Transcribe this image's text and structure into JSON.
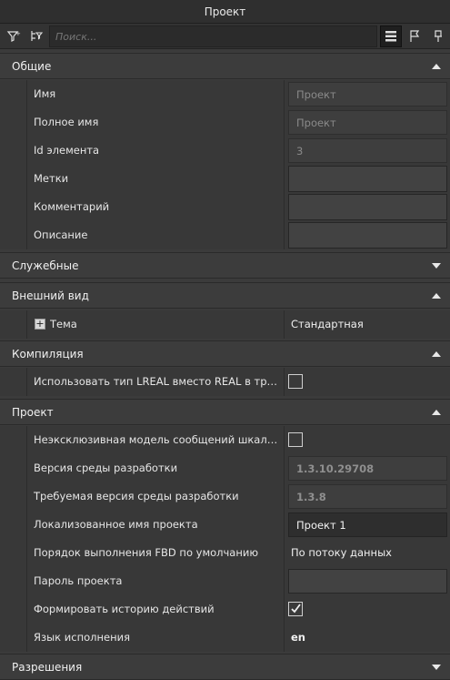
{
  "window": {
    "title": "Проект"
  },
  "toolbar": {
    "search_placeholder": "Поиск...",
    "buttons": [
      "filter-icon",
      "tree-filter-icon",
      "list-view-icon",
      "flag-icon",
      "pin-icon"
    ]
  },
  "sections": {
    "general": {
      "title": "Общие",
      "rows": [
        {
          "label": "Имя",
          "value": "Проект"
        },
        {
          "label": "Полное имя",
          "value": "Проект"
        },
        {
          "label": "Id элемента",
          "value": "3"
        },
        {
          "label": "Метки",
          "value": ""
        },
        {
          "label": "Комментарий",
          "value": ""
        },
        {
          "label": "Описание",
          "value": ""
        }
      ]
    },
    "service": {
      "title": "Служебные"
    },
    "appearance": {
      "title": "Внешний вид",
      "rows": [
        {
          "label": "Тема",
          "value": "Стандартная"
        }
      ]
    },
    "compile": {
      "title": "Компиляция",
      "rows": [
        {
          "label": "Использовать тип LREAL вместо REAL в трансл...",
          "checked": false
        }
      ]
    },
    "project": {
      "title": "Проект",
      "rows": [
        {
          "label": "Неэксклюзивная модель сообщений шкалы AI",
          "checked": false
        },
        {
          "label": "Версия среды разработки",
          "value": "1.3.10.29708"
        },
        {
          "label": "Требуемая версия среды разработки",
          "value": "1.3.8"
        },
        {
          "label": "Локализованное имя проекта",
          "value": "Проект 1"
        },
        {
          "label": "Порядок выполнения FBD по умолчанию",
          "value": "По потоку данных"
        },
        {
          "label": "Пароль проекта",
          "value": ""
        },
        {
          "label": "Формировать историю действий",
          "checked": true
        },
        {
          "label": "Язык исполнения",
          "value": "en"
        }
      ]
    },
    "permissions": {
      "title": "Разрешения"
    }
  },
  "colors": {
    "background": "#3b3b3b",
    "header": "#2f2f2f",
    "text": "#e6e6e6",
    "muted": "#8a8a8a"
  }
}
